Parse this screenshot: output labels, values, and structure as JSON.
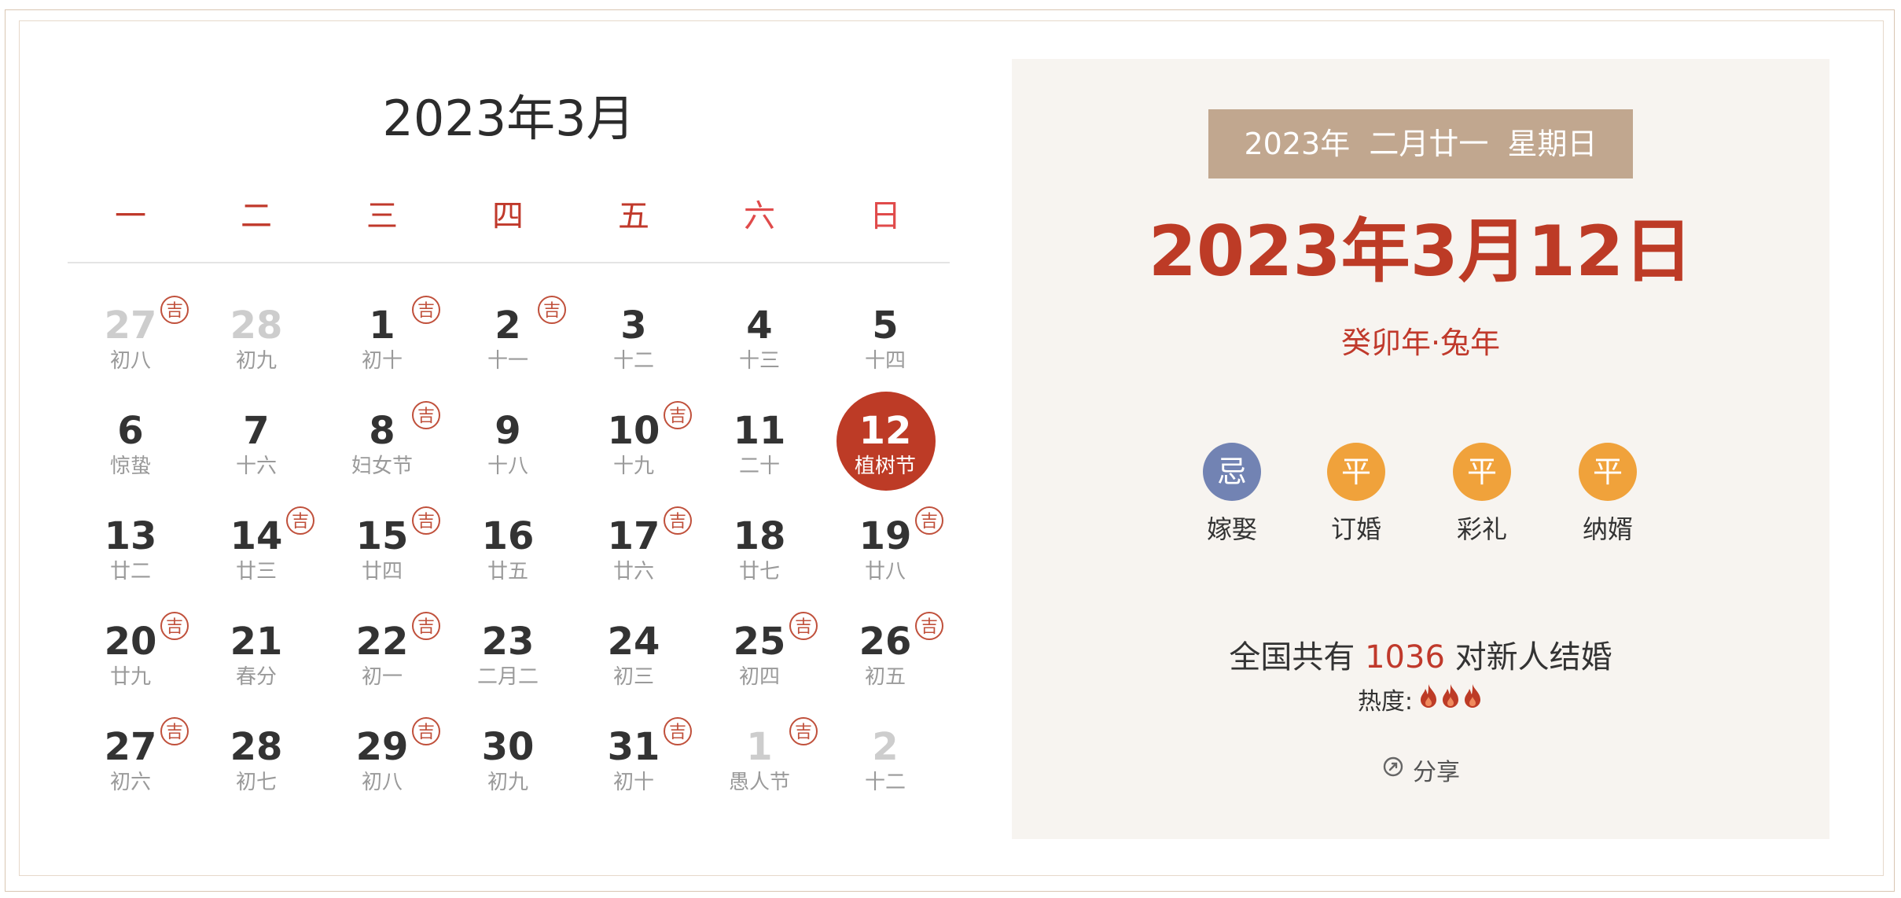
{
  "calendar": {
    "title": "2023年3月",
    "weekdays": [
      "一",
      "二",
      "三",
      "四",
      "五",
      "六",
      "日"
    ],
    "ji_label": "吉",
    "days": [
      {
        "d": "27",
        "l": "初八",
        "ji": true,
        "muted": true
      },
      {
        "d": "28",
        "l": "初九",
        "ji": false,
        "muted": true
      },
      {
        "d": "1",
        "l": "初十",
        "ji": true
      },
      {
        "d": "2",
        "l": "十一",
        "ji": true
      },
      {
        "d": "3",
        "l": "十二"
      },
      {
        "d": "4",
        "l": "十三"
      },
      {
        "d": "5",
        "l": "十四"
      },
      {
        "d": "6",
        "l": "惊蛰"
      },
      {
        "d": "7",
        "l": "十六"
      },
      {
        "d": "8",
        "l": "妇女节",
        "ji": true
      },
      {
        "d": "9",
        "l": "十八"
      },
      {
        "d": "10",
        "l": "十九",
        "ji": true
      },
      {
        "d": "11",
        "l": "二十"
      },
      {
        "d": "12",
        "l": "植树节",
        "selected": true
      },
      {
        "d": "13",
        "l": "廿二"
      },
      {
        "d": "14",
        "l": "廿三",
        "ji": true
      },
      {
        "d": "15",
        "l": "廿四",
        "ji": true
      },
      {
        "d": "16",
        "l": "廿五"
      },
      {
        "d": "17",
        "l": "廿六",
        "ji": true
      },
      {
        "d": "18",
        "l": "廿七"
      },
      {
        "d": "19",
        "l": "廿八",
        "ji": true
      },
      {
        "d": "20",
        "l": "廿九",
        "ji": true
      },
      {
        "d": "21",
        "l": "春分"
      },
      {
        "d": "22",
        "l": "初一",
        "ji": true
      },
      {
        "d": "23",
        "l": "二月二"
      },
      {
        "d": "24",
        "l": "初三"
      },
      {
        "d": "25",
        "l": "初四",
        "ji": true
      },
      {
        "d": "26",
        "l": "初五",
        "ji": true
      },
      {
        "d": "27",
        "l": "初六",
        "ji": true
      },
      {
        "d": "28",
        "l": "初七"
      },
      {
        "d": "29",
        "l": "初八",
        "ji": true
      },
      {
        "d": "30",
        "l": "初九"
      },
      {
        "d": "31",
        "l": "初十",
        "ji": true
      },
      {
        "d": "1",
        "l": "愚人节",
        "ji": true,
        "muted": true
      },
      {
        "d": "2",
        "l": "十二",
        "muted": true
      }
    ]
  },
  "detail": {
    "lunar_banner": "2023年  二月廿一  星期日",
    "big_date": "2023年3月12日",
    "ganzhi": "癸卯年·兔年",
    "items": [
      {
        "badge": "忌",
        "label": "嫁娶",
        "kind": "bad"
      },
      {
        "badge": "平",
        "label": "订婚",
        "kind": "ping"
      },
      {
        "badge": "平",
        "label": "彩礼",
        "kind": "ping"
      },
      {
        "badge": "平",
        "label": "纳婿",
        "kind": "ping"
      }
    ],
    "stats_prefix": "全国共有 ",
    "stats_count": "1036",
    "stats_suffix": " 对新人结婚",
    "heat_label": "热度:",
    "heat_level": 3,
    "share_label": "分享"
  },
  "colors": {
    "accent_red": "#bd3b26",
    "bad_badge": "#7283b3",
    "ping_badge": "#f0a23b",
    "banner": "#c1a78f"
  }
}
